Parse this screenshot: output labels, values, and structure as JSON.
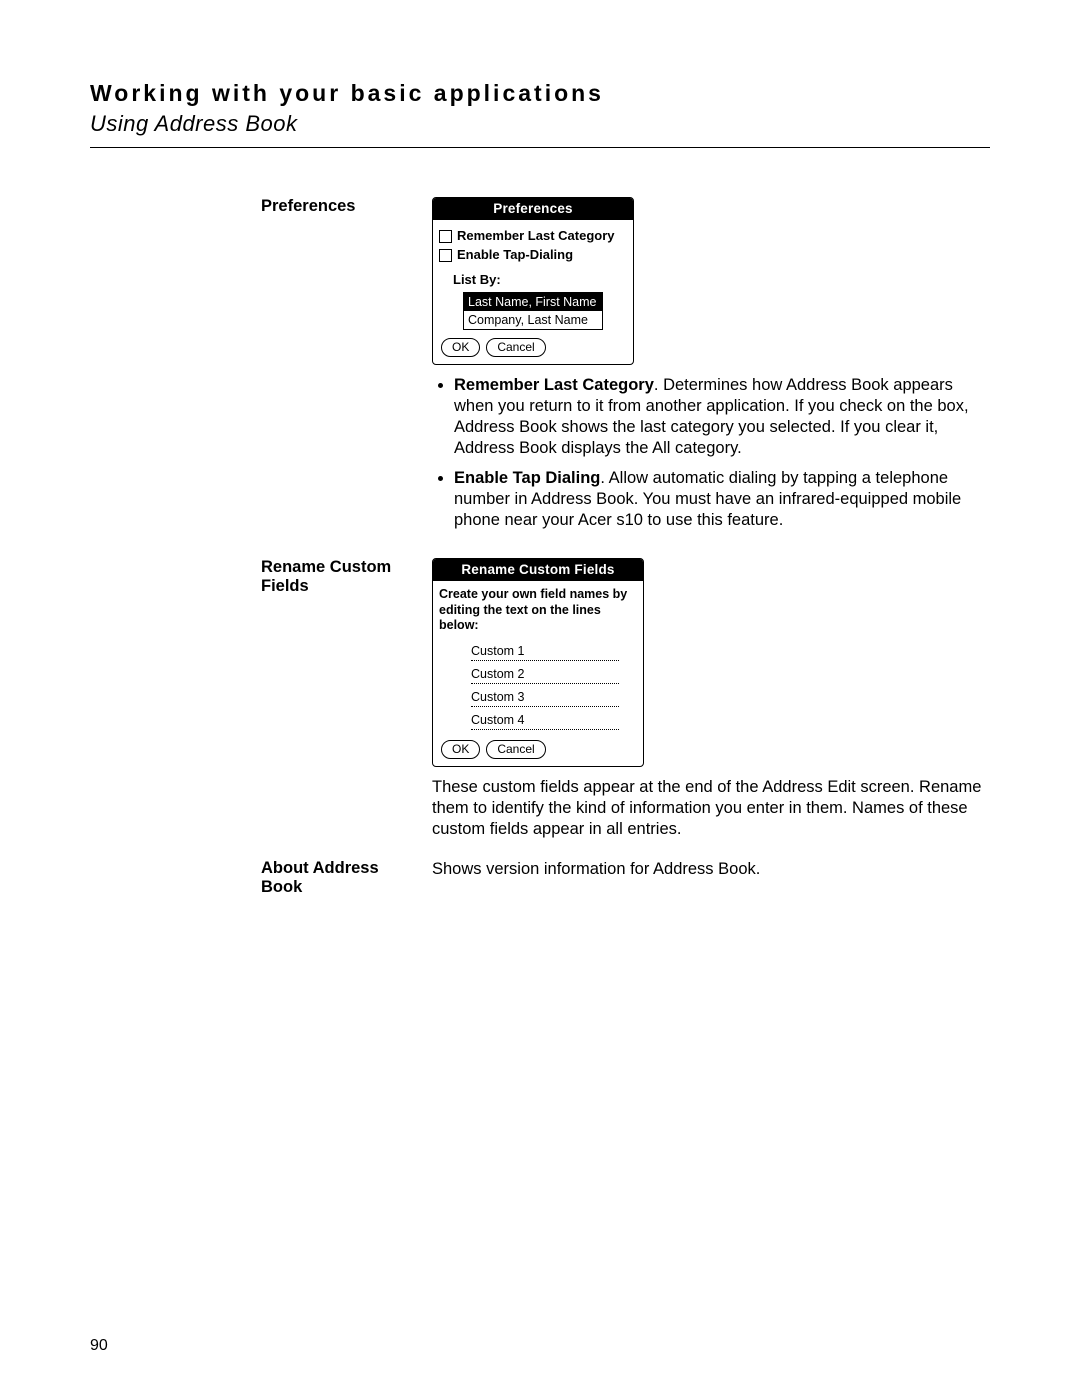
{
  "header": {
    "title": "Working with your basic applications",
    "subtitle": "Using Address Book"
  },
  "sections": {
    "preferences": {
      "label": "Preferences",
      "dialog": {
        "title": "Preferences",
        "check1": "Remember Last Category",
        "check2": "Enable Tap-Dialing",
        "listby_label": "List By:",
        "option1": "Last Name, First Name",
        "option2": "Company, Last Name",
        "ok": "OK",
        "cancel": "Cancel"
      },
      "bullets": {
        "b1_bold": "Remember Last Category",
        "b1_rest": ". Determines how Address Book appears when you return to it from another application. If you check on the box, Address Book shows the last category you selected. If you clear it, Address Book displays the All category.",
        "b2_bold": "Enable Tap Dialing",
        "b2_rest": ". Allow automatic dialing by tapping a telephone number in Address Book. You must have an infrared-equipped mobile phone near your Acer s10 to use this feature."
      }
    },
    "rename": {
      "label": "Rename Custom Fields",
      "dialog": {
        "title": "Rename Custom Fields",
        "instruction": "Create your own field names by editing the text on the lines below:",
        "f1": "Custom 1",
        "f2": "Custom 2",
        "f3": "Custom 3",
        "f4": "Custom 4",
        "ok": "OK",
        "cancel": "Cancel"
      },
      "desc": "These custom fields appear at the end of the Address Edit screen. Rename them to identify the kind of information you enter in them. Names of these custom fields appear in all entries."
    },
    "about": {
      "label": "About Address Book",
      "desc": "Shows version information for Address Book."
    }
  },
  "page_number": "90"
}
